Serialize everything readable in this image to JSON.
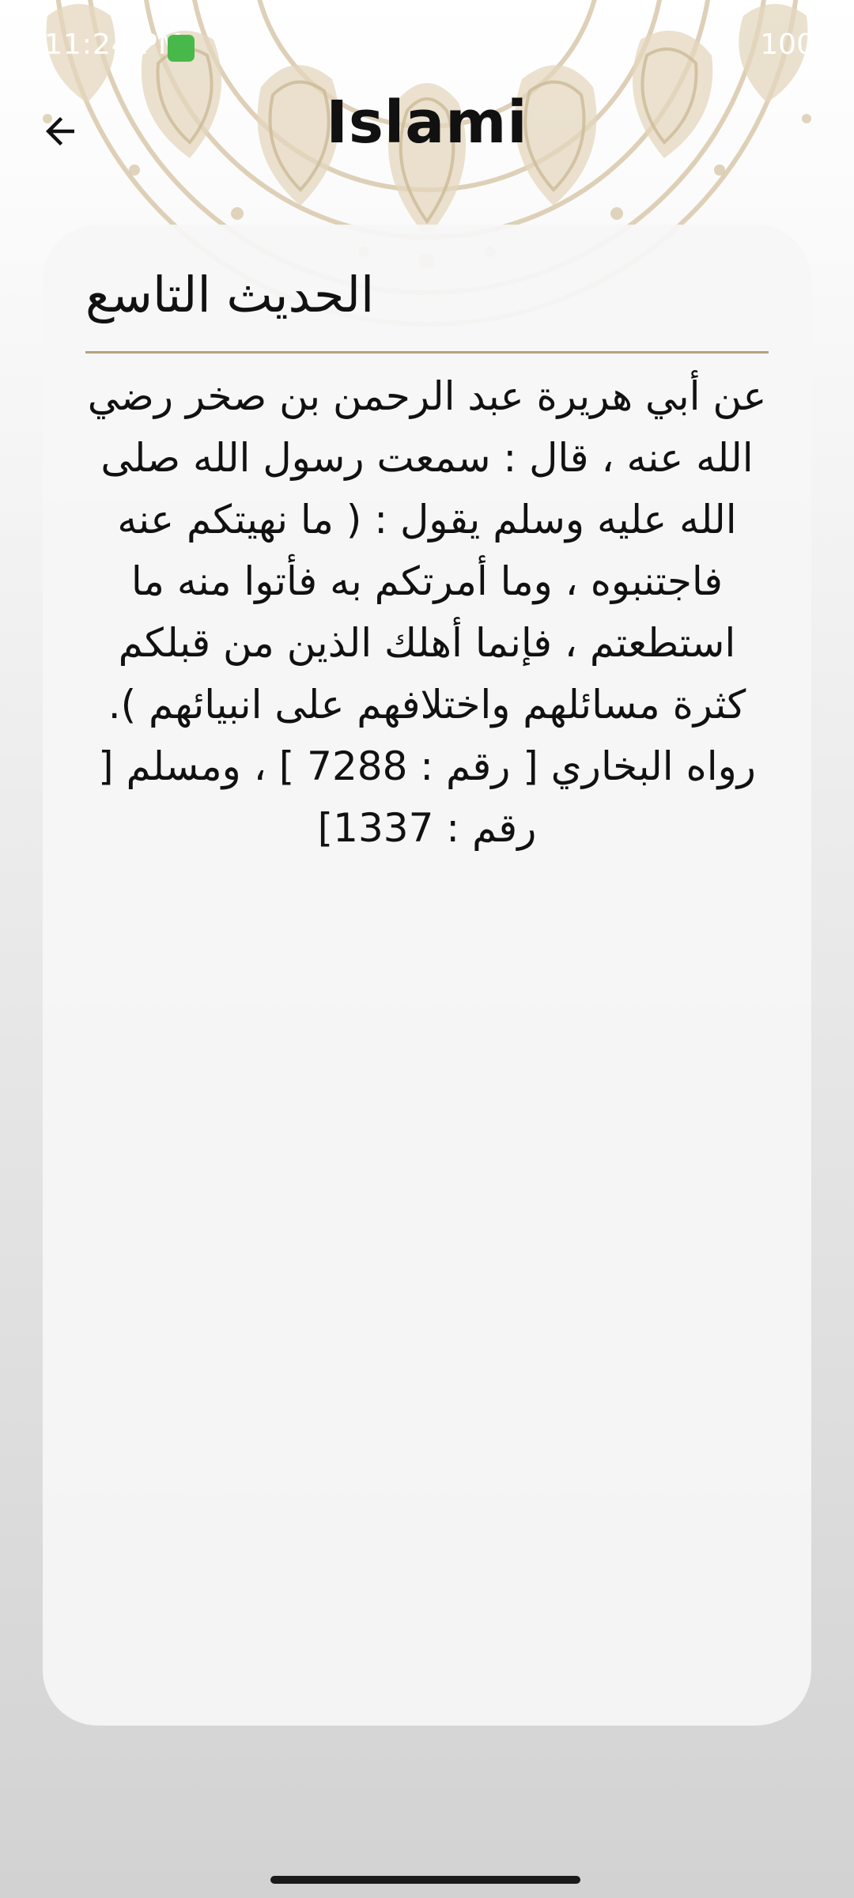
{
  "status_bar": {
    "time": "11:24 PM",
    "battery": "100",
    "app_icon": "android-robot-icon"
  },
  "app_bar": {
    "title": "Islami",
    "back_icon": "arrow-back-icon"
  },
  "hadith": {
    "title": "الحديث التاسع",
    "body": "عن أبي هريرة عبد الرحمن بن صخر رضي الله عنه ، قال : سمعت رسول الله صلى الله عليه وسلم يقول : ( ما نهيتكم عنه فاجتنبوه ، وما أمرتكم به فأتوا منه ما استطعتم ، فإنما أهلك الذين من قبلكم كثرة مسائلهم واختلافهم على انبيائهم ). رواه البخاري [ رقم : 7288 ] ، ومسلم [ رقم : 1337]"
  },
  "colors": {
    "accent": "#b8a27e",
    "mandala": "#d9c9ac",
    "card": "#f6f6f6",
    "text": "#111111"
  }
}
